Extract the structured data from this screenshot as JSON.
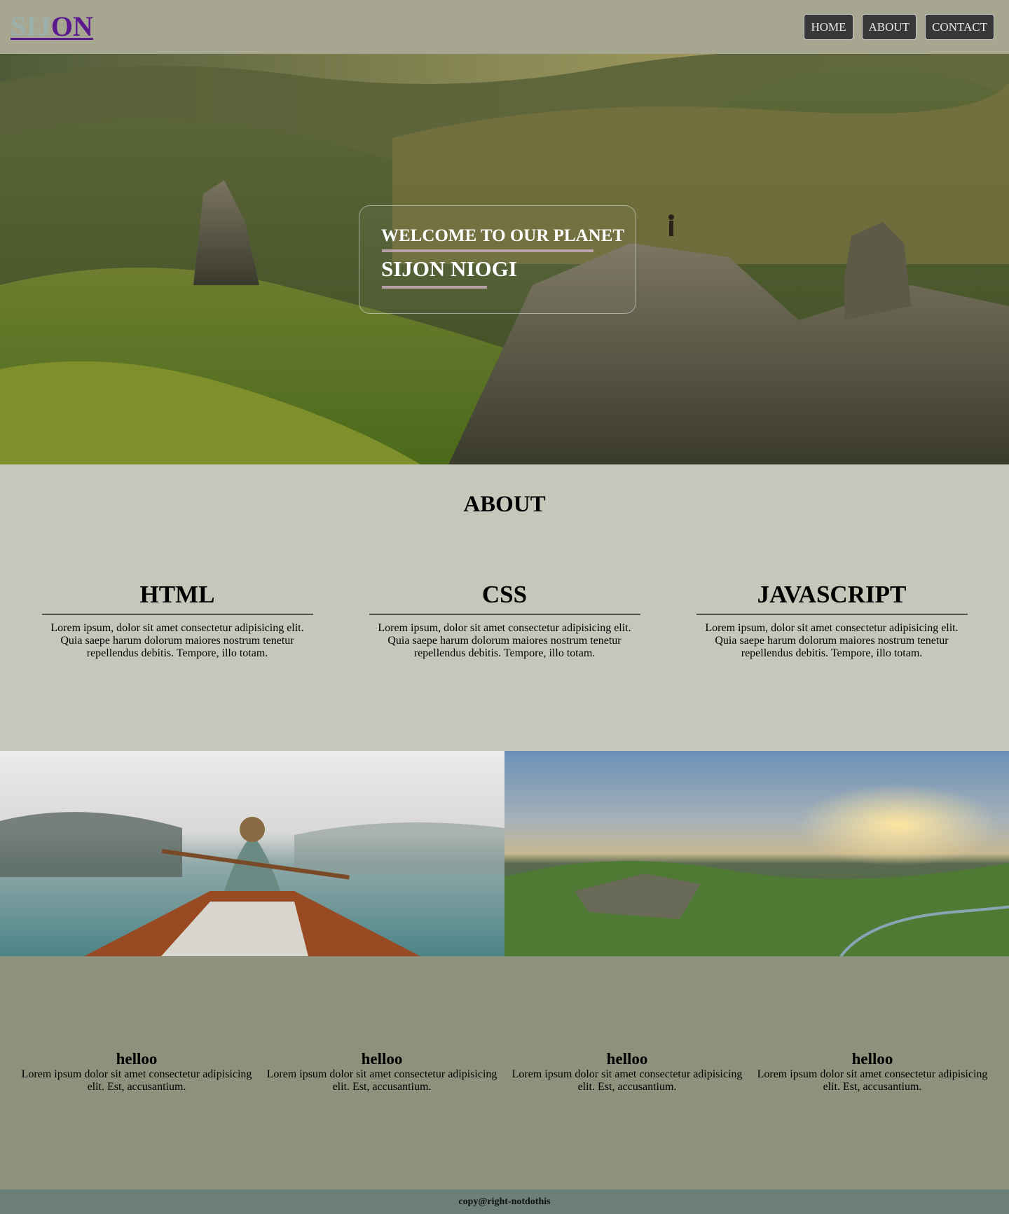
{
  "header": {
    "logo_part1": "SIJ",
    "logo_part2": "ON",
    "nav": [
      "HOME",
      "ABOUT",
      "CONTACT"
    ]
  },
  "hero": {
    "title": "WELCOME TO OUR PLANET",
    "name": "SIJON NIOGI"
  },
  "about": {
    "heading": "ABOUT",
    "columns": [
      {
        "title": "HTML",
        "text": "Lorem ipsum, dolor sit amet consectetur adipisicing elit. Quia saepe harum dolorum maiores nostrum tenetur repellendus debitis. Tempore, illo totam."
      },
      {
        "title": "CSS",
        "text": "Lorem ipsum, dolor sit amet consectetur adipisicing elit. Quia saepe harum dolorum maiores nostrum tenetur repellendus debitis. Tempore, illo totam."
      },
      {
        "title": "JAVASCRIPT",
        "text": "Lorem ipsum, dolor sit amet consectetur adipisicing elit. Quia saepe harum dolorum maiores nostrum tenetur repellendus debitis. Tempore, illo totam."
      }
    ]
  },
  "cards": [
    {
      "title": "helloo",
      "text": "Lorem ipsum dolor sit amet consectetur adipisicing elit. Est, accusantium."
    },
    {
      "title": "helloo",
      "text": "Lorem ipsum dolor sit amet consectetur adipisicing elit. Est, accusantium."
    },
    {
      "title": "helloo",
      "text": "Lorem ipsum dolor sit amet consectetur adipisicing elit. Est, accusantium."
    },
    {
      "title": "helloo",
      "text": "Lorem ipsum dolor sit amet consectetur adipisicing elit. Est, accusantium."
    }
  ],
  "footer": {
    "text": "copy@right-notdothis"
  },
  "colors": {
    "header_bg": "#a6a691",
    "logo_accent": "#5b1a8e",
    "nav_button_bg": "#38383a",
    "about_bg": "#c6c7bb",
    "cards_bg": "#8e917b",
    "footer_bg": "#6d7f79"
  },
  "images": {
    "hero": "mountain-landscape-hiker-photo",
    "gallery_left": "woman-canoeing-misty-lake-photo",
    "gallery_right": "green-valley-sunset-clouds-photo"
  }
}
